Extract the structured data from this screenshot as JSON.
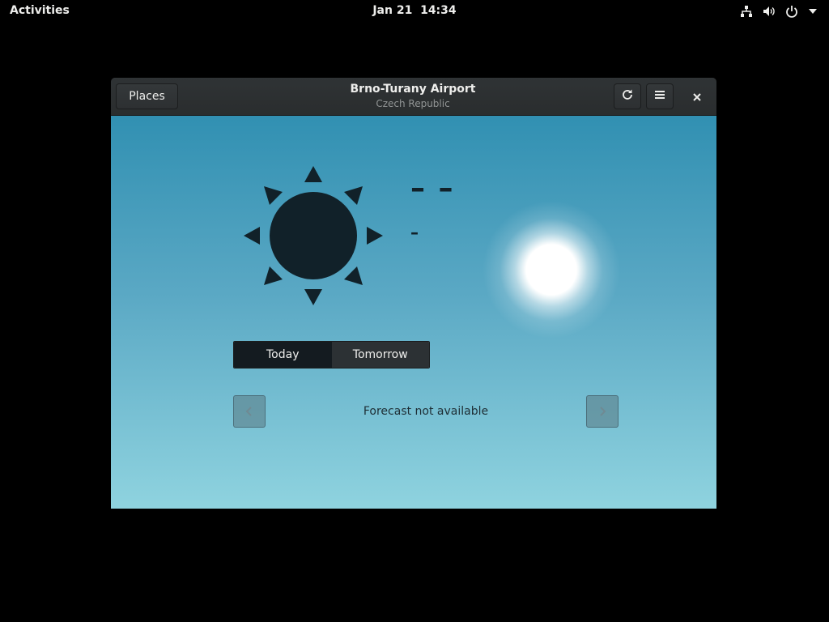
{
  "topbar": {
    "activities_label": "Activities",
    "date": "Jan 21",
    "time": "14:34",
    "icons": [
      "network-icon",
      "volume-icon",
      "power-icon",
      "dropdown-arrow-icon"
    ]
  },
  "window": {
    "places_label": "Places",
    "title": "Brno-Turany Airport",
    "subtitle": "Czech Republic",
    "buttons": [
      "refresh-icon",
      "hamburger-menu-icon",
      "close-icon"
    ]
  },
  "weather": {
    "condition_icon": "sun-icon",
    "temperature": "– –",
    "conditions": "–"
  },
  "forecast": {
    "tabs": [
      {
        "label": "Today",
        "active": true
      },
      {
        "label": "Tomorrow",
        "active": false
      }
    ],
    "message": "Forecast not available"
  },
  "colors": {
    "sky_top": "#3190b2",
    "sky_bottom": "#8fd3df",
    "icon_dark": "#112129",
    "headerbar": "#2f3335"
  }
}
